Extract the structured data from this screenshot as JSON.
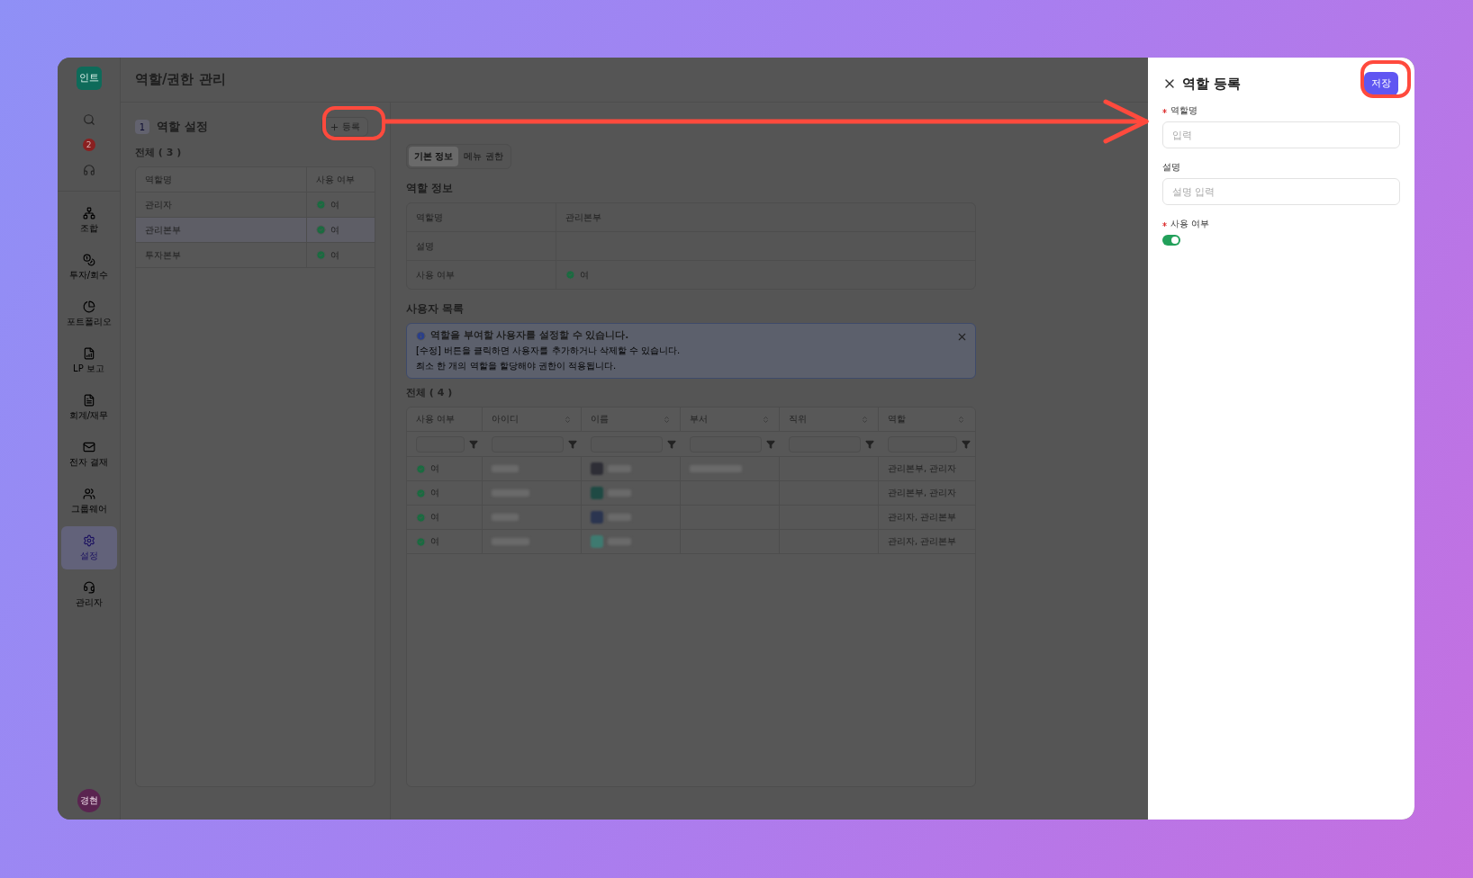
{
  "app": {
    "logo": "인트",
    "title": "역할/권한 관리",
    "notification_count": "2",
    "avatar": "경현"
  },
  "sidebar": {
    "items": [
      {
        "label": "조합",
        "selected": false
      },
      {
        "label": "투자/회수",
        "selected": false
      },
      {
        "label": "포트폴리오",
        "selected": false
      },
      {
        "label": "LP 보고",
        "selected": false
      },
      {
        "label": "회계/재무",
        "selected": false
      },
      {
        "label": "전자 결재",
        "selected": false
      },
      {
        "label": "그룹웨어",
        "selected": false
      },
      {
        "label": "설정",
        "selected": true
      },
      {
        "label": "관리자",
        "selected": false
      }
    ]
  },
  "roles_panel": {
    "step": "1",
    "title": "역할 설정",
    "add_button": "등록",
    "count": "전체 ( 3 )",
    "columns": [
      "역할명",
      "사용 여부"
    ],
    "rows": [
      {
        "name": "관리자",
        "status": "여",
        "active": true,
        "selected": false
      },
      {
        "name": "관리본부",
        "status": "여",
        "active": true,
        "selected": true
      },
      {
        "name": "투자본부",
        "status": "여",
        "active": true,
        "selected": false
      }
    ]
  },
  "detail_panel": {
    "tabs": [
      {
        "label": "기본 정보",
        "selected": true
      },
      {
        "label": "메뉴 권한",
        "selected": false
      }
    ],
    "info_title": "역할 정보",
    "info_rows": [
      {
        "label": "역할명",
        "kind": "text",
        "value": "관리본부"
      },
      {
        "label": "설명",
        "kind": "text"
      },
      {
        "label": "사용 여부",
        "kind": "status",
        "value": "여",
        "active": true
      }
    ],
    "users_title": "사용자 목록",
    "notice": {
      "title": "역할을 부여할 사용자를 설정할 수 있습니다.",
      "lines": [
        "[수정] 버튼을 클릭하면 사용자를 추가하거나 삭제할 수 있습니다.",
        "최소 한 개의 역할을 할당해야 권한이 적용됩니다."
      ]
    },
    "users_count": "전체 ( 4 )",
    "columns": [
      {
        "label": "사용 여부",
        "sortable": false
      },
      {
        "label": "아이디",
        "sortable": true
      },
      {
        "label": "이름",
        "sortable": true
      },
      {
        "label": "부서",
        "sortable": true
      },
      {
        "label": "직위",
        "sortable": true
      },
      {
        "label": "역할",
        "sortable": true
      }
    ],
    "rows": [
      {
        "status": "여",
        "active": true,
        "color": "#2e2e36",
        "has_department": true,
        "roles": "관리본부, 관리자"
      },
      {
        "status": "여",
        "active": true,
        "color": "#1f4a44",
        "has_department": false,
        "roles": "관리본부, 관리자"
      },
      {
        "status": "여",
        "active": true,
        "color": "#2b3550",
        "has_department": false,
        "roles": "관리자, 관리본부"
      },
      {
        "status": "여",
        "active": true,
        "color": "#3e7a70",
        "has_department": false,
        "roles": "관리자, 관리본부"
      }
    ]
  },
  "drawer": {
    "title": "역할 등록",
    "save_button": "저장",
    "fields": [
      {
        "label": "역할명",
        "required": true,
        "kind": "input",
        "placeholder": "입력"
      },
      {
        "label": "설명",
        "required": false,
        "kind": "input",
        "placeholder": "설명 입력"
      },
      {
        "label": "사용 여부",
        "required": true,
        "kind": "toggle",
        "on": true
      }
    ]
  }
}
